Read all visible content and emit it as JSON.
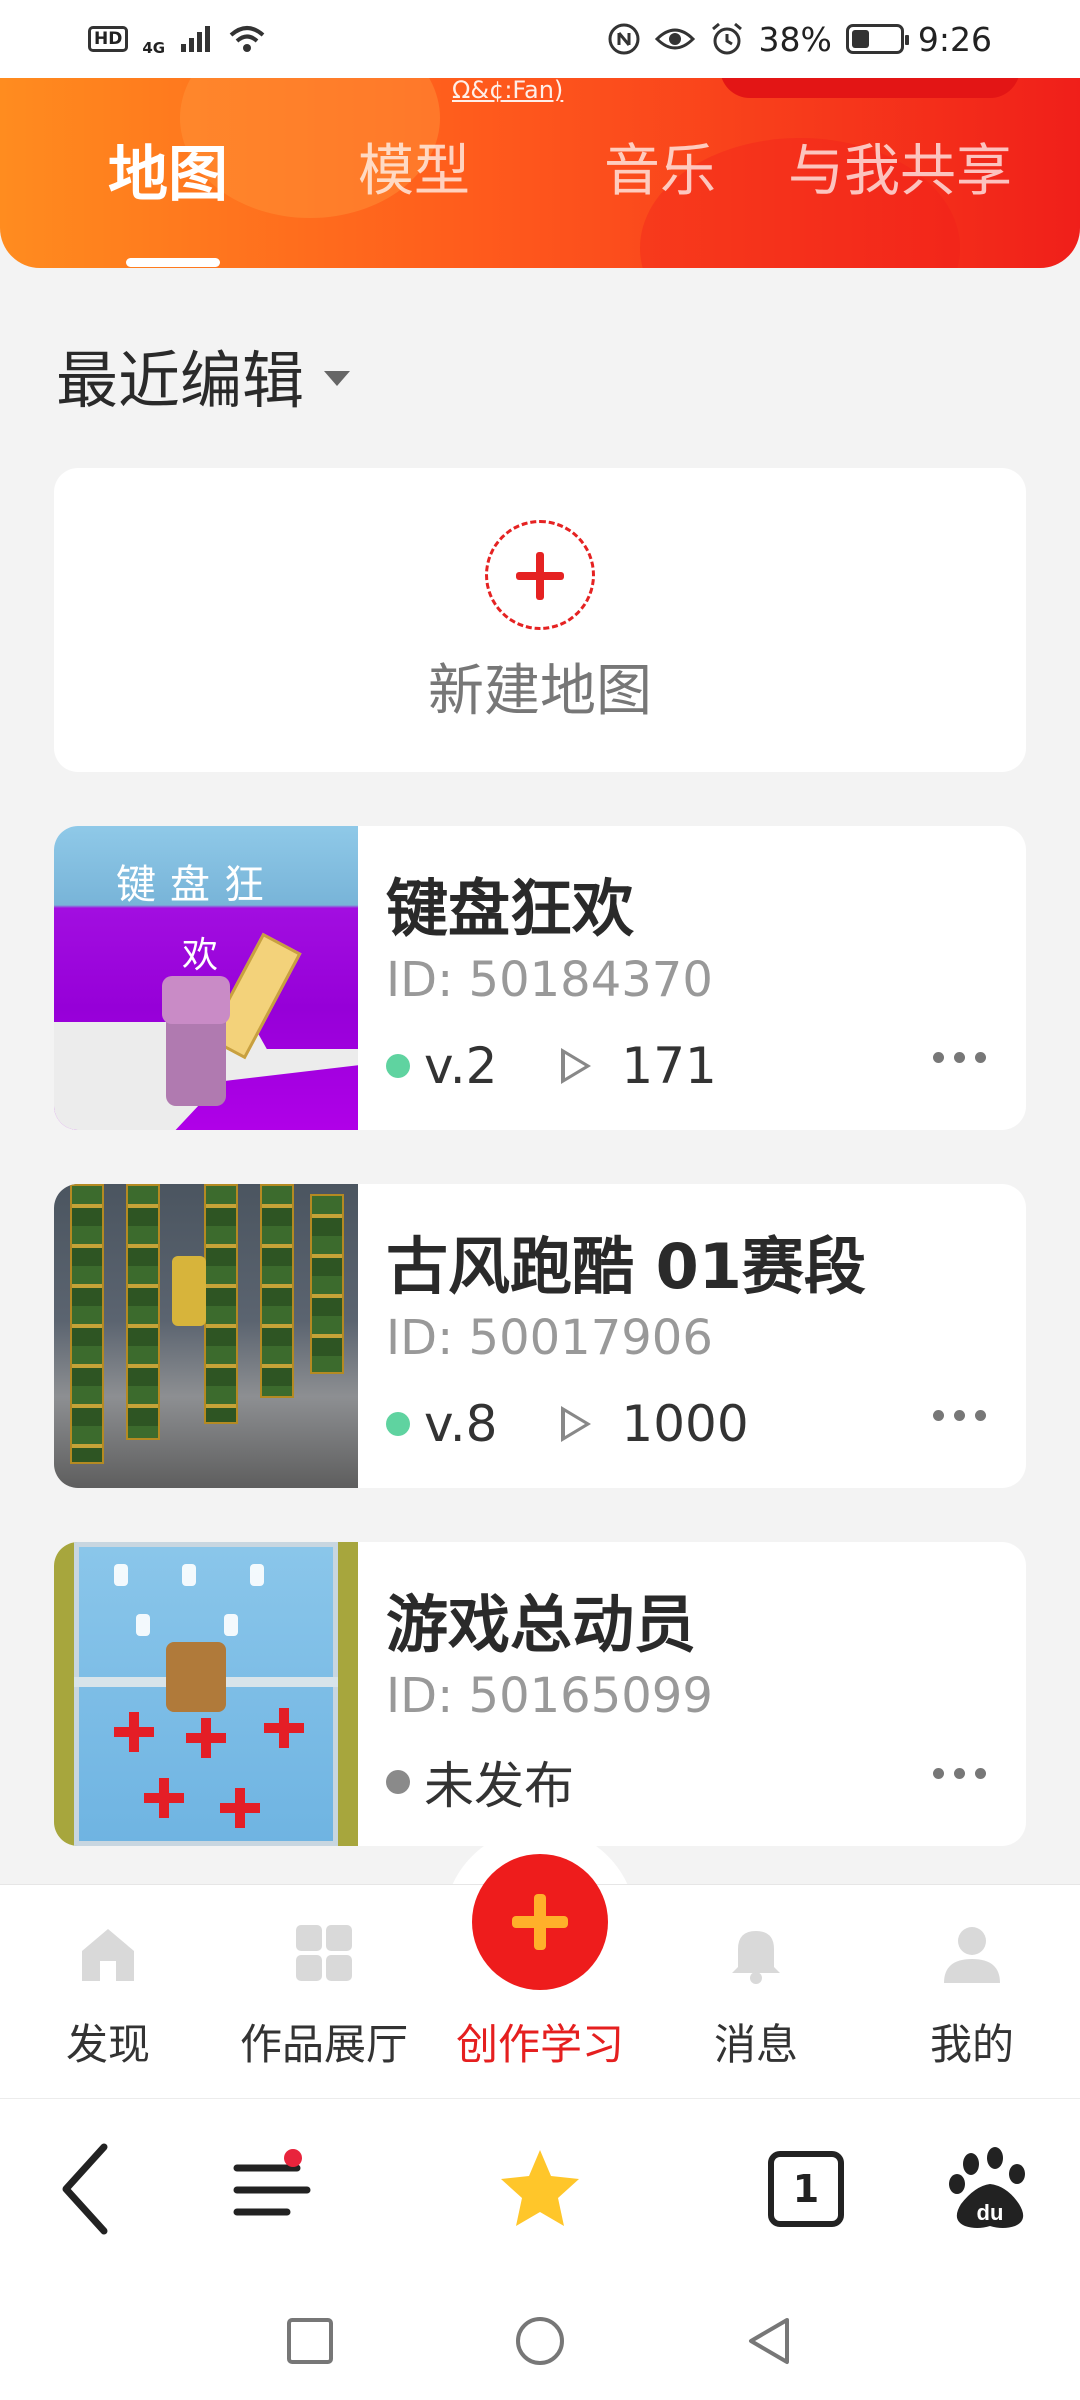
{
  "status_bar": {
    "network_badge": "HD",
    "signal_label": "4G",
    "battery_percent": "38%",
    "battery_level": 0.38,
    "time": "9:26"
  },
  "header": {
    "cutoff_text": "Ω&¢:Fan)",
    "tabs": [
      {
        "label": "地图",
        "active": true
      },
      {
        "label": "模型",
        "active": false
      },
      {
        "label": "音乐",
        "active": false
      },
      {
        "label": "与我共享",
        "active": false
      }
    ]
  },
  "section": {
    "title": "最近编辑"
  },
  "new_map": {
    "label": "新建地图"
  },
  "maps": [
    {
      "title": "键盘狂欢",
      "id": "ID: 50184370",
      "status": "published",
      "version": "v.2",
      "plays": "171"
    },
    {
      "title": "古风跑酷 01赛段",
      "id": "ID: 50017906",
      "status": "published",
      "version": "v.8",
      "plays": "1000"
    },
    {
      "title": "游戏总动员",
      "id": "ID: 50165099",
      "status": "unpublished",
      "unpublished_label": "未发布"
    }
  ],
  "thumb_texts": {
    "map1_line1": "键盘狂",
    "map1_line2": "欢"
  },
  "bottom_nav": {
    "items": [
      {
        "label": "发现",
        "icon": "home-icon"
      },
      {
        "label": "作品展厅",
        "icon": "grid-icon"
      },
      {
        "label": "创作学习",
        "icon": "plus-icon",
        "active": true
      },
      {
        "label": "消息",
        "icon": "bell-icon"
      },
      {
        "label": "我的",
        "icon": "user-icon"
      }
    ]
  },
  "browser_bar": {
    "tab_count": "1",
    "icons": [
      "back-icon",
      "menu-icon",
      "star-icon",
      "tabs-icon",
      "baidu-icon"
    ]
  },
  "colors": {
    "accent_red": "#e51f1f",
    "header_start": "#ff8c1f",
    "header_end": "#f01f1a",
    "published_dot": "#5fd3a0",
    "unpublished_dot": "#8a8a8a"
  }
}
